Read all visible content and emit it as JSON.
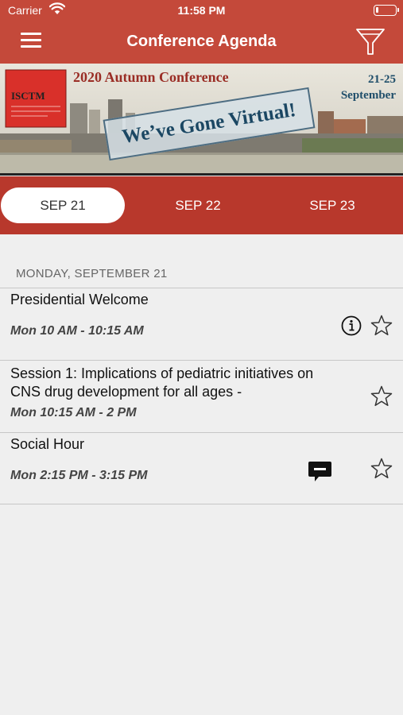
{
  "status_bar": {
    "carrier": "Carrier",
    "time": "11:58 PM"
  },
  "nav": {
    "title": "Conference Agenda"
  },
  "banner": {
    "logo_text": "ISCTM",
    "conference_title": "2020 Autumn Conference",
    "dates_line1": "21-25",
    "dates_line2": "September",
    "stamp_text": "We’ve Gone Virtual!"
  },
  "date_tabs": [
    {
      "label": "SEP 21",
      "active": true
    },
    {
      "label": "SEP 22",
      "active": false
    },
    {
      "label": "SEP 23",
      "active": false
    }
  ],
  "section": {
    "header": "MONDAY, SEPTEMBER 21"
  },
  "sessions": [
    {
      "title": "Presidential Welcome",
      "time": "Mon 10 AM - 10:15 AM",
      "has_info": true,
      "has_chat": false
    },
    {
      "title": "Session 1: Implications of pediatric initiatives on CNS drug development for all ages -",
      "time": "Mon 10:15 AM - 2 PM",
      "has_info": false,
      "has_chat": false
    },
    {
      "title": "Social Hour",
      "time": "Mon 2:15 PM - 3:15 PM",
      "has_info": false,
      "has_chat": true
    }
  ],
  "colors": {
    "header_red": "#c4493a",
    "tab_bar_red": "#b8382c",
    "background": "#efefef"
  },
  "icons": [
    "wifi-icon",
    "battery-icon",
    "hamburger-menu-icon",
    "filter-funnel-icon",
    "info-icon",
    "star-outline-icon",
    "chat-bubble-icon"
  ]
}
